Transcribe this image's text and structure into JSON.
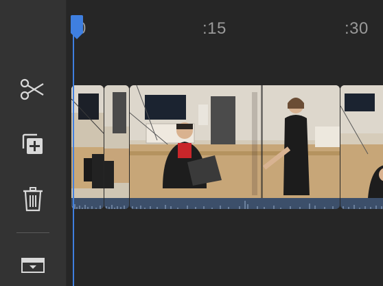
{
  "ruler": {
    "labels": [
      "0",
      ":15",
      ":30"
    ]
  },
  "toolbar": {
    "split": "scissors-icon",
    "duplicate": "duplicate-plus-icon",
    "delete": "trash-icon",
    "collapse": "panel-collapse-icon"
  },
  "colors": {
    "sidebar": "#333333",
    "background": "#262626",
    "playhead": "#3f7fe0",
    "selection": "#e6953a",
    "waveform": "#3c4f6a"
  }
}
